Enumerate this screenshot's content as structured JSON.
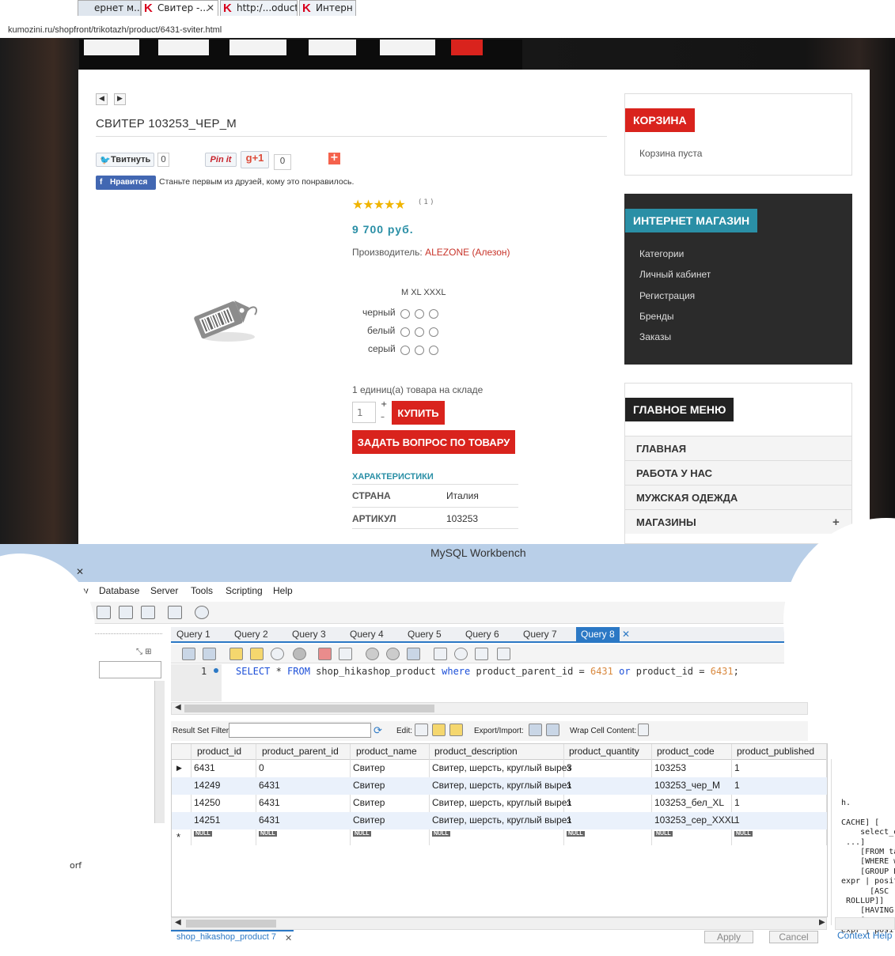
{
  "browser": {
    "tabs": [
      {
        "label": "ернет м..."
      },
      {
        "label": "Свитер -..."
      },
      {
        "label": "http:/...oduct"
      },
      {
        "label": "Интерн"
      }
    ],
    "url": "kumozini.ru/shopfront/trikotazh/product/6431-sviter.html"
  },
  "product": {
    "title": "СВИТЕР 103253_ЧЕР_М",
    "tweet_label": "Твитнуть",
    "tweet_count": "0",
    "pin_label": "Pin it",
    "gplus_label": "+1",
    "gplus_count": "0",
    "fb_label": "Нравится",
    "fb_text": "Станьте первым из друзей, кому это понравилось.",
    "rating": 5,
    "rating_count": "( 1 )",
    "price": "9 700 руб.",
    "manufacturer_label": "Производитель: ",
    "manufacturer": "ALEZONE (Алезон)",
    "size_header": "M XL XXXL",
    "colors": [
      "черный",
      "белый",
      "серый"
    ],
    "stock": "1 единиц(а) товара на складе",
    "qty": "1",
    "qty_plus": "+",
    "qty_minus": "–",
    "buy": "КУПИТЬ",
    "ask": "ЗАДАТЬ ВОПРОС ПО ТОВАРУ",
    "characteristics_title": "ХАРАКТЕРИСТИКИ",
    "characteristics": [
      {
        "key": "СТРАНА",
        "value": "Италия"
      },
      {
        "key": "АРТИКУЛ",
        "value": "103253"
      }
    ]
  },
  "sidebar": {
    "cart_title": "КОРЗИНА",
    "cart_text": "Корзина пуста",
    "shop_title": "ИНТЕРНЕТ МАГАЗИН",
    "shop_links": [
      "Категории",
      "Личный кабинет",
      "Регистрация",
      "Бренды",
      "Заказы"
    ],
    "menu_title": "ГЛАВНОЕ МЕНЮ",
    "menu_items": [
      "ГЛАВНАЯ",
      "РАБОТА У НАС",
      "МУЖСКАЯ ОДЕЖДА",
      "МАГАЗИНЫ"
    ],
    "menu_expand": "+"
  },
  "workbench": {
    "title": "MySQL Workbench",
    "menu": [
      "Query",
      "Database",
      "Server",
      "Tools",
      "Scripting",
      "Help"
    ],
    "query_tabs": [
      "Query 1",
      "Query 2",
      "Query 3",
      "Query 4",
      "Query 5",
      "Query 6",
      "Query 7",
      "Query 8"
    ],
    "active_tab": "Query 8",
    "line_number": "1",
    "sql": {
      "select": "SELECT",
      "star": " * ",
      "from": "FROM",
      "table": " shop_hikashop_product ",
      "where": "where",
      "cond1": " product_parent_id = ",
      "val1": "6431",
      "or": " or",
      "cond2": " product_id = ",
      "val2": "6431",
      "end": ";"
    },
    "result_filter_label": "Result Set Filter:",
    "edit_label": "Edit:",
    "export_label": "Export/Import:",
    "wrap_label": "Wrap Cell Content:",
    "columns": [
      "product_id",
      "product_parent_id",
      "product_name",
      "product_description",
      "product_quantity",
      "product_code",
      "product_published"
    ],
    "rows": [
      [
        "6431",
        "0",
        "Свитер",
        "Свитер, шерсть, круглый вырез",
        "3",
        "103253",
        "1"
      ],
      [
        "14249",
        "6431",
        "Свитер",
        "Свитер, шерсть, круглый вырез",
        "1",
        "103253_чер_М",
        "1"
      ],
      [
        "14250",
        "6431",
        "Свитер",
        "Свитер, шерсть, круглый вырез",
        "1",
        "103253_бел_XL",
        "1"
      ],
      [
        "14251",
        "6431",
        "Свитер",
        "Свитер, шерсть, круглый вырез",
        "1",
        "103253_сер_XXXL",
        "1"
      ]
    ],
    "null_label": "NULL",
    "new_row_marker": "*",
    "current_row_marker": "▶",
    "result_tab": "shop_hikashop_product 7",
    "apply": "Apply",
    "cancel": "Cancel",
    "context_help": "Context Help",
    "help_snippet": "h.\n\nCACHE] [\n    select_e\n ...]\n    [FROM ta\n    [WHERE w\n    [GROUP B\nexpr | posit\n      [ASC\n ROLLUP]]\n    [HAVING\n    [ORDER B\nexpr | posit",
    "left_fragment": "orf"
  }
}
